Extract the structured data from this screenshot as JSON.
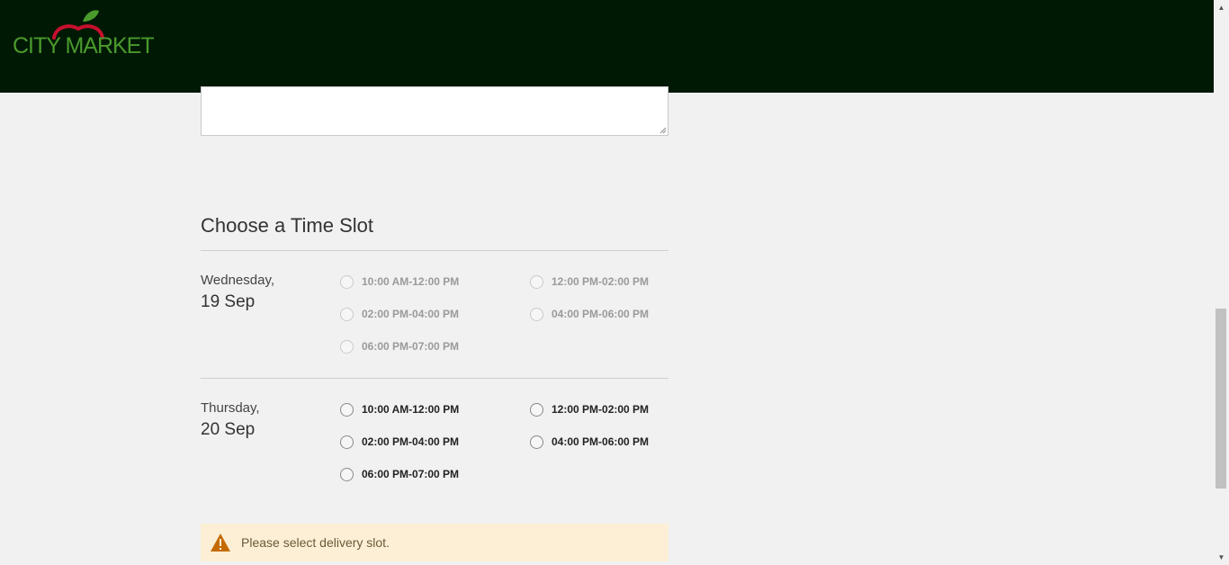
{
  "header": {
    "logo_text": "CITY MARKET",
    "brand_color": "#4a9a2c",
    "apple_color": "#c8102e",
    "background": "#001905"
  },
  "notes": {
    "value": ""
  },
  "time_slot": {
    "title": "Choose a Time Slot",
    "days": [
      {
        "day": "Wednesday,",
        "date": "19 Sep",
        "available": false,
        "slots": [
          "10:00 AM-12:00 PM",
          "12:00 PM-02:00 PM",
          "02:00 PM-04:00 PM",
          "04:00 PM-06:00 PM",
          "06:00 PM-07:00 PM"
        ]
      },
      {
        "day": "Thursday,",
        "date": "20 Sep",
        "available": true,
        "slots": [
          "10:00 AM-12:00 PM",
          "12:00 PM-02:00 PM",
          "02:00 PM-04:00 PM",
          "04:00 PM-06:00 PM",
          "06:00 PM-07:00 PM"
        ]
      }
    ]
  },
  "alert": {
    "icon": "warning-icon",
    "text": "Please select delivery slot.",
    "color": "#fcefd5",
    "icon_color": "#c46b00"
  }
}
